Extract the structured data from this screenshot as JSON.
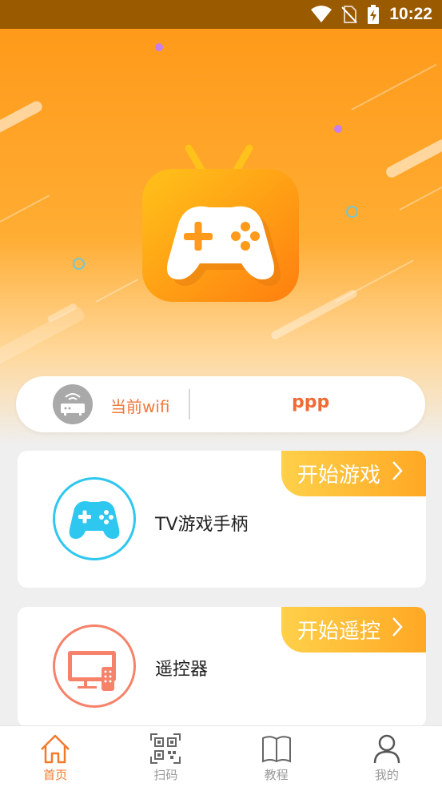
{
  "status_bar": {
    "time": "10:22",
    "icons": [
      "wifi-icon",
      "no-sim-icon",
      "battery-charging-icon"
    ]
  },
  "hero": {
    "logo": "tv-gamepad-logo-icon"
  },
  "wifi": {
    "label": "当前wifi",
    "network_name": "ppp",
    "icon": "router-icon"
  },
  "features": [
    {
      "title": "TV游戏手柄",
      "action_label": "开始游戏",
      "icon": "gamepad-icon",
      "accent": "#2ec7f0"
    },
    {
      "title": "遥控器",
      "action_label": "开始遥控",
      "icon": "tv-remote-icon",
      "accent": "#f6826a"
    }
  ],
  "nav": {
    "items": [
      {
        "label": "首页",
        "icon": "home-icon",
        "active": true
      },
      {
        "label": "扫码",
        "icon": "qr-code-icon",
        "active": false
      },
      {
        "label": "教程",
        "icon": "book-icon",
        "active": false
      },
      {
        "label": "我的",
        "icon": "profile-icon",
        "active": false
      }
    ],
    "active_color": "#f07a2e",
    "inactive_color": "#999999"
  },
  "colors": {
    "brand_orange": "#ff9a1a",
    "accent_text": "#f07a3e",
    "status_bar": "#9a5a00"
  }
}
